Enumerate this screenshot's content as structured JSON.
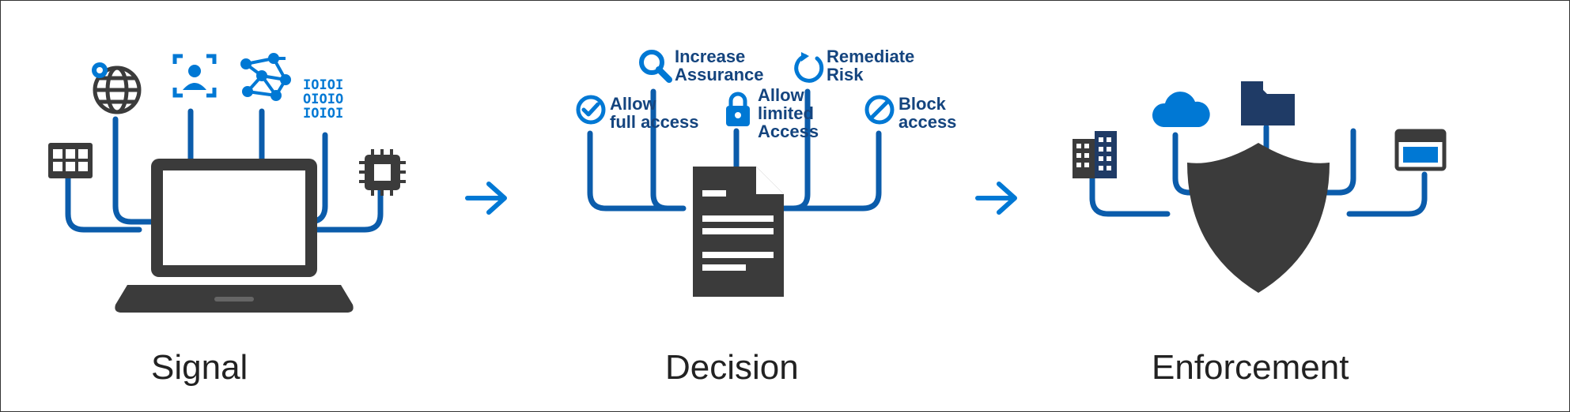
{
  "stages": {
    "signal": {
      "label": "Signal"
    },
    "decision": {
      "label": "Decision",
      "options": {
        "allow_full": "Allow\nfull access",
        "increase_assurance": "Increase\nAssurance",
        "allow_limited": "Allow\nlimited\nAccess",
        "remediate_risk": "Remediate\nRisk",
        "block_access": "Block\naccess"
      }
    },
    "enforcement": {
      "label": "Enforcement"
    }
  },
  "icons": {
    "signal": [
      "calendar-grid-icon",
      "globe-icon",
      "user-focus-icon",
      "network-graph-icon",
      "binary-data-icon",
      "chip-icon",
      "laptop-icon"
    ],
    "decision_center": "document-policy-icon",
    "decision_options": [
      "check-circle-icon",
      "magnifier-icon",
      "lock-icon",
      "refresh-arrow-icon",
      "block-circle-icon"
    ],
    "enforcement": [
      "building-icon",
      "cloud-icon",
      "folder-icon",
      "browser-window-icon",
      "shield-icon"
    ]
  },
  "colors": {
    "accent": "#0078d4",
    "dark": "#3b3b3b",
    "navy": "#1f3b66",
    "label": "#14447e"
  }
}
